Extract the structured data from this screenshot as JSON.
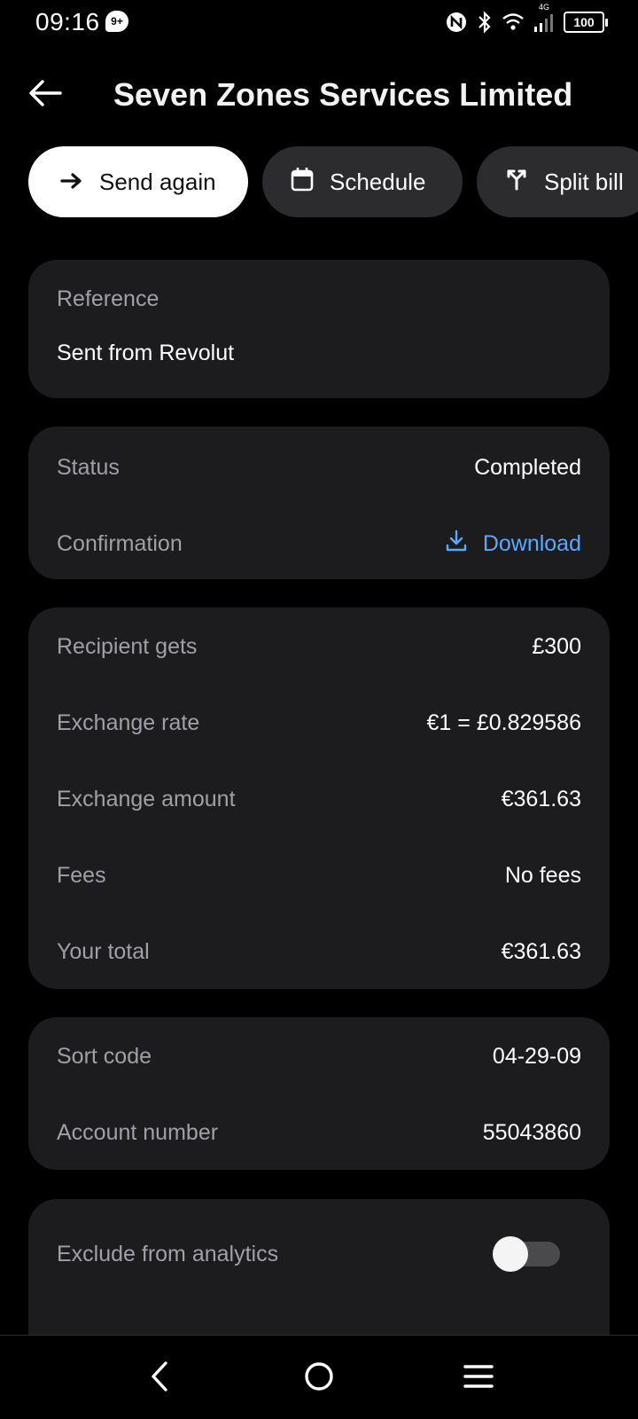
{
  "status_bar": {
    "time": "09:16",
    "notification_badge": "9+",
    "network": "4G",
    "battery": "100",
    "icons": [
      "nfc-icon",
      "bluetooth-icon",
      "wifi-icon",
      "signal-icon",
      "battery-icon"
    ]
  },
  "header": {
    "title": "Seven Zones Services Limited",
    "back_icon": "arrow-left-icon"
  },
  "actions": {
    "send_again": "Send again",
    "schedule": "Schedule",
    "split_bill": "Split bill"
  },
  "reference": {
    "label": "Reference",
    "value": "Sent from Revolut"
  },
  "status_card": {
    "status_label": "Status",
    "status_value": "Completed",
    "confirmation_label": "Confirmation",
    "download_label": "Download"
  },
  "amounts": [
    {
      "label": "Recipient gets",
      "value": "£300"
    },
    {
      "label": "Exchange rate",
      "value": "€1 = £0.829586"
    },
    {
      "label": "Exchange amount",
      "value": "€361.63"
    },
    {
      "label": "Fees",
      "value": "No fees"
    },
    {
      "label": "Your total",
      "value": "€361.63"
    }
  ],
  "account": {
    "sort_code_label": "Sort code",
    "sort_code_value": "04-29-09",
    "account_number_label": "Account number",
    "account_number_value": "55043860"
  },
  "analytics": {
    "exclude_label": "Exclude from analytics",
    "exclude_enabled": false
  },
  "colors": {
    "background": "#000000",
    "card": "#1c1c1e",
    "chip_secondary": "#2c2c2e",
    "label": "#a0a0a5",
    "link": "#5aa9ff"
  }
}
